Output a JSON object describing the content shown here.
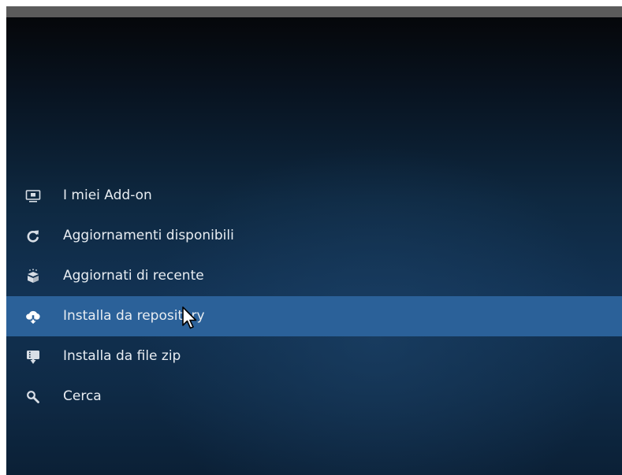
{
  "window": {
    "top_bar_color": "#5b5b5b",
    "background_colors": [
      "#05070a",
      "#123253"
    ]
  },
  "menu": {
    "selected_color": "#2b6199",
    "items": [
      {
        "label": "I miei Add-on",
        "icon": "monitor-box-icon",
        "selected": false
      },
      {
        "label": "Aggiornamenti disponibili",
        "icon": "refresh-icon",
        "selected": false
      },
      {
        "label": "Aggiornati di recente",
        "icon": "open-box-icon",
        "selected": false
      },
      {
        "label": "Installa da repository",
        "icon": "cloud-download-icon",
        "selected": true
      },
      {
        "label": "Installa da file zip",
        "icon": "zip-install-icon",
        "selected": false
      },
      {
        "label": "Cerca",
        "icon": "search-icon",
        "selected": false
      }
    ]
  },
  "cursor": {
    "icon": "mouse-pointer-icon"
  }
}
